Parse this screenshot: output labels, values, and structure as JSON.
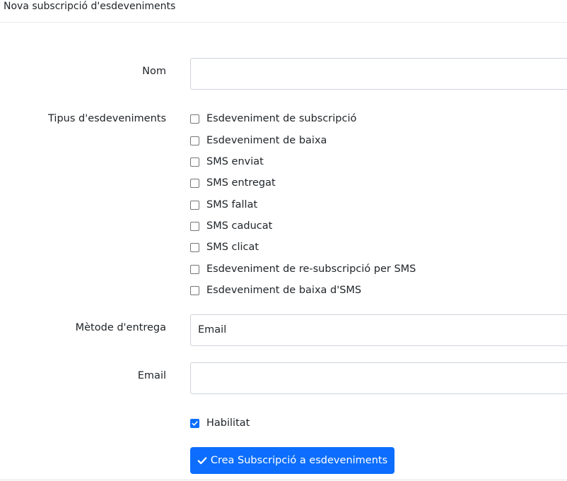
{
  "header": {
    "title": "Nova subscripció d'esdeveniments"
  },
  "form": {
    "name": {
      "label": "Nom",
      "value": ""
    },
    "event_types": {
      "label": "Tipus d'esdeveniments",
      "options": [
        {
          "label": "Esdeveniment de subscripció",
          "checked": false
        },
        {
          "label": "Esdeveniment de baixa",
          "checked": false
        },
        {
          "label": "SMS enviat",
          "checked": false
        },
        {
          "label": "SMS entregat",
          "checked": false
        },
        {
          "label": "SMS fallat",
          "checked": false
        },
        {
          "label": "SMS caducat",
          "checked": false
        },
        {
          "label": "SMS clicat",
          "checked": false
        },
        {
          "label": "Esdeveniment de re-subscripció per SMS",
          "checked": false
        },
        {
          "label": "Esdeveniment de baixa d'SMS",
          "checked": false
        }
      ]
    },
    "delivery_method": {
      "label": "Mètode d'entrega",
      "value": "Email"
    },
    "email": {
      "label": "Email",
      "value": ""
    },
    "enabled": {
      "label": "Habilitat",
      "checked": true
    },
    "submit": {
      "label": "Crea Subscripció a esdeveniments",
      "icon": "check-icon"
    }
  },
  "colors": {
    "primary": "#0d6efd",
    "border": "#ced4da",
    "text": "#212529"
  }
}
